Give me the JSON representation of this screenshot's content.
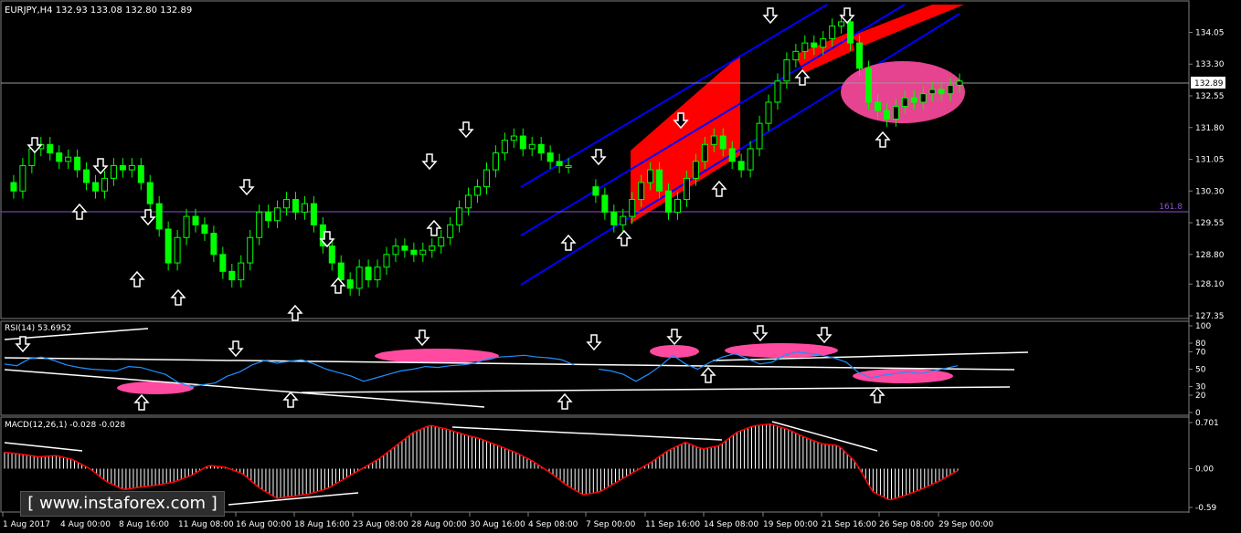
{
  "chart_data": [
    {
      "type": "line",
      "panel": "price",
      "title": "EURJPY,H4  132.93 133.08 132.80 132.89",
      "ylim": [
        127.35,
        134.6
      ],
      "y_ticks": [
        "134.05",
        "133.30",
        "132.55",
        "131.80",
        "131.05",
        "130.30",
        "129.55",
        "128.80",
        "128.10",
        "127.35"
      ],
      "current_price": "132.89",
      "fib_level": {
        "label": "161.8",
        "value": 129.82
      },
      "series": [
        {
          "values": [
            130.5,
            130.3,
            130.9,
            131.3,
            131.4,
            131.2,
            131.0,
            131.1,
            130.8,
            130.5,
            130.3,
            130.6,
            130.9,
            130.8,
            130.9,
            130.5,
            130.0,
            129.4,
            128.6,
            129.2,
            129.7,
            129.5,
            129.3,
            128.8,
            128.4,
            128.2,
            128.6,
            129.2,
            129.8,
            129.6,
            129.9,
            130.1,
            129.8,
            130.0,
            129.5,
            129.0,
            128.6,
            128.2,
            128.0,
            128.5,
            128.2,
            128.5,
            128.8,
            129.0,
            128.9,
            128.8,
            128.9,
            129.0,
            129.2,
            129.5,
            129.9,
            130.2,
            130.4,
            130.8,
            131.2,
            131.5,
            131.6,
            131.3,
            131.4,
            131.2,
            131.0,
            130.9,
            130.9,
            null,
            130.4,
            130.2,
            129.8,
            129.5,
            129.7,
            130.1,
            130.5,
            130.8,
            130.3,
            129.8,
            130.1,
            130.6,
            131.0,
            131.4,
            131.6,
            131.3,
            131.0,
            130.8,
            131.3,
            131.9,
            132.4,
            132.9,
            133.4,
            133.6,
            133.8,
            133.7,
            133.9,
            134.2,
            134.3,
            133.8,
            133.2,
            132.4,
            132.2,
            132.0,
            132.3,
            132.5,
            132.4,
            132.6,
            132.7,
            132.6,
            132.8,
            132.9
          ]
        }
      ]
    },
    {
      "type": "line",
      "panel": "rsi",
      "title": "RSI(14) 53.6952",
      "ylim": [
        0,
        100
      ],
      "y_ticks": [
        "100",
        "80",
        "70",
        "50",
        "30",
        "20",
        "0"
      ],
      "series": [
        {
          "values": [
            56,
            54,
            62,
            64,
            60,
            55,
            52,
            50,
            49,
            48,
            53,
            52,
            48,
            44,
            35,
            30,
            32,
            34,
            42,
            47,
            55,
            60,
            57,
            59,
            61,
            56,
            50,
            46,
            42,
            36,
            40,
            44,
            48,
            50,
            53,
            52,
            54,
            55,
            57,
            62,
            64,
            65,
            66,
            64,
            63,
            61,
            55,
            null,
            50,
            48,
            44,
            36,
            44,
            54,
            66,
            56,
            50,
            58,
            64,
            68,
            62,
            56,
            58,
            66,
            70,
            68,
            66,
            63,
            58,
            46,
            40,
            43,
            45,
            47,
            45,
            48,
            51,
            54
          ]
        }
      ]
    },
    {
      "type": "bar",
      "panel": "macd",
      "title": "MACD(12,26,1) -0.028 -0.028",
      "ylim": [
        -0.59,
        0.701
      ],
      "y_ticks": [
        "0.701",
        "0.00",
        "-0.59"
      ],
      "series": [
        {
          "values": [
            0.25,
            0.22,
            0.18,
            0.2,
            0.14,
            0.0,
            -0.2,
            -0.32,
            -0.28,
            -0.25,
            -0.2,
            -0.1,
            0.05,
            0.02,
            -0.08,
            -0.3,
            -0.45,
            -0.42,
            -0.38,
            -0.3,
            -0.15,
            0.0,
            0.15,
            0.35,
            0.55,
            0.66,
            0.6,
            0.52,
            0.45,
            0.35,
            0.25,
            0.12,
            -0.05,
            -0.25,
            -0.4,
            -0.35,
            -0.2,
            -0.05,
            0.1,
            0.28,
            0.4,
            0.3,
            0.35,
            0.55,
            0.65,
            0.68,
            0.6,
            0.48,
            0.38,
            0.35,
            0.1,
            -0.35,
            -0.48,
            -0.4,
            -0.3,
            -0.18,
            -0.03
          ]
        }
      ]
    }
  ],
  "x_labels": [
    "1 Aug 2017",
    "4 Aug 00:00",
    "8 Aug 16:00",
    "11 Aug 08:00",
    "16 Aug 00:00",
    "18 Aug 16:00",
    "23 Aug 08:00",
    "28 Aug 00:00",
    "30 Aug 16:00",
    "4 Sep 08:00",
    "7 Sep 00:00",
    "11 Sep 16:00",
    "14 Sep 08:00",
    "19 Sep 00:00",
    "21 Sep 16:00",
    "26 Sep 08:00",
    "29 Sep 00:00"
  ],
  "watermark": "[ www.instaforex.com ]",
  "colors": {
    "background": "#000000",
    "candles": "#00ff00",
    "channel": "#0000ff",
    "fill_red": "#ff0000",
    "highlight": "#ff4aa0",
    "rsi_line": "#1e90ff",
    "macd_bars": "#ffffff",
    "macd_signal": "#ff0000",
    "fib_line": "#8855cc",
    "grid": "#7f7f7f"
  }
}
